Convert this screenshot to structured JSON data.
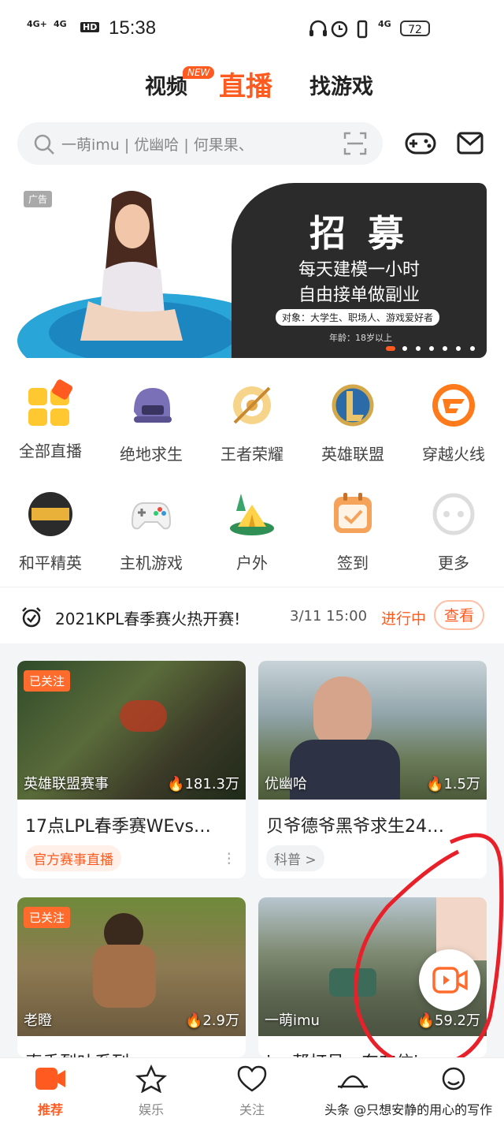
{
  "status_bar": {
    "sig1": "4G+",
    "sig2": "4G",
    "hd": "HD",
    "time": "15:38",
    "sig3": "4G",
    "battery": "72"
  },
  "top_tabs": [
    {
      "label": "视频"
    },
    {
      "label": "直播"
    },
    {
      "label": "找游戏"
    }
  ],
  "new_badge": "NEW",
  "search": {
    "placeholder": "一萌imu | 优幽哈 | 何果果、"
  },
  "banner": {
    "ad_tag": "广告",
    "title": "招 募",
    "line1": "每天建模一小时",
    "line2": "自由接单做副业",
    "line3": "对象：大学生、职场人、游戏爱好者",
    "line4": "年龄：18岁以上"
  },
  "categories": [
    {
      "label": "全部直播"
    },
    {
      "label": "绝地求生"
    },
    {
      "label": "王者荣耀"
    },
    {
      "label": "英雄联盟"
    },
    {
      "label": "穿越火线"
    },
    {
      "label": "和平精英"
    },
    {
      "label": "主机游戏"
    },
    {
      "label": "户外"
    },
    {
      "label": "签到"
    },
    {
      "label": "更多"
    }
  ],
  "notice": {
    "text": "2021KPL春季赛火热开赛!",
    "date": "3/11  15:00",
    "status": "进行中",
    "button": "查看"
  },
  "cards": [
    {
      "tag": "已关注",
      "category": "英雄联盟赛事",
      "views": "181.3万",
      "title": "17点LPL春季赛WEvs…",
      "pill": "官方赛事直播"
    },
    {
      "tag": "",
      "category": "优幽哈",
      "views": "1.5万",
      "title": "贝爷德爷黑爷求生24…",
      "pill": "科普 >"
    },
    {
      "tag": "已关注",
      "category": "老瞪",
      "views": "2.9万",
      "title": "真香烈叶系列",
      "pill": ""
    },
    {
      "tag": "",
      "category": "一萌imu",
      "views": "59.2万",
      "title": "ioe帮打号一东东信ing",
      "pill": ""
    }
  ],
  "bottom_nav": [
    {
      "label": "推荐"
    },
    {
      "label": "娱乐"
    },
    {
      "label": "关注"
    },
    {
      "label": ""
    },
    {
      "label": ""
    }
  ],
  "watermark": "头条 @只想安静的用心的写作",
  "colors": {
    "accent": "#ff5a1f"
  }
}
